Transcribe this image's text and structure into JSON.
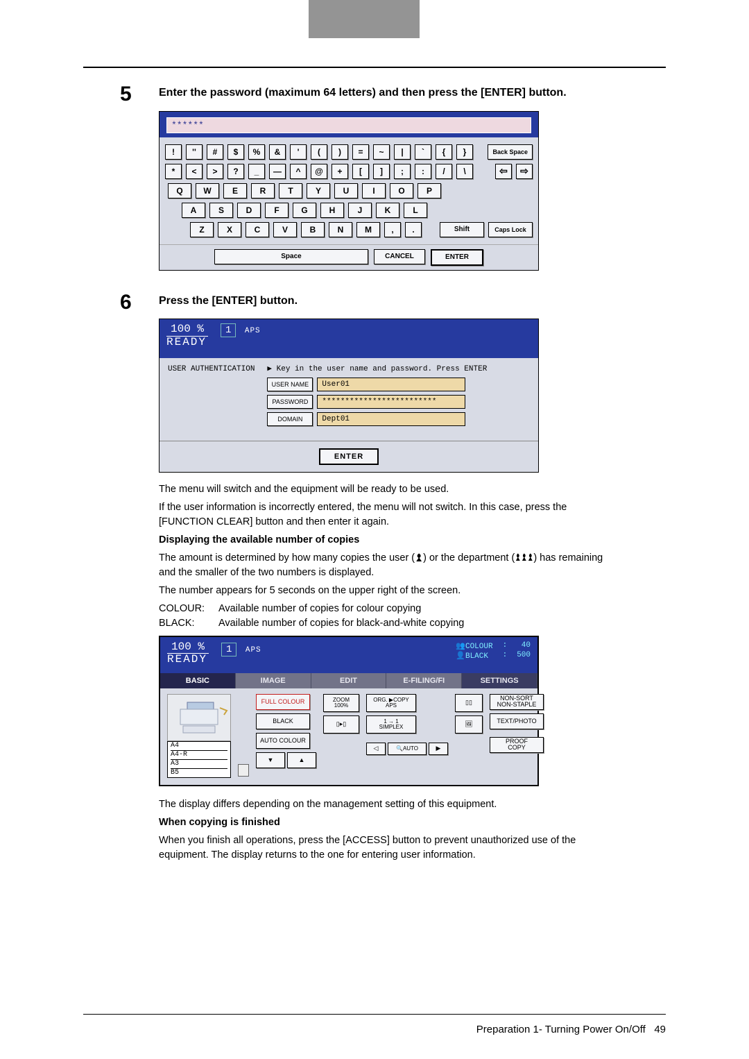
{
  "step5": {
    "num": "5",
    "title": "Enter the password (maximum 64 letters) and then press the [ENTER] button."
  },
  "keyboard": {
    "input_value": "******",
    "row1": [
      "!",
      "''",
      "#",
      "$",
      "%",
      "&",
      "'",
      "(",
      ")",
      "=",
      "~",
      "|",
      "`",
      "{",
      "}"
    ],
    "backspace": "Back Space",
    "row2": [
      "*",
      "<",
      ">",
      "?",
      "_",
      "—",
      "^",
      "@",
      "+",
      "[",
      "]",
      ";",
      ":",
      "/",
      "\\"
    ],
    "arrow_left": "←",
    "arrow_right": "→",
    "row3": [
      "Q",
      "W",
      "E",
      "R",
      "T",
      "Y",
      "U",
      "I",
      "O",
      "P"
    ],
    "row4": [
      "A",
      "S",
      "D",
      "F",
      "G",
      "H",
      "J",
      "K",
      "L"
    ],
    "row5": [
      "Z",
      "X",
      "C",
      "V",
      "B",
      "N",
      "M",
      ",",
      "."
    ],
    "shift": "Shift",
    "caps": "Caps Lock",
    "space": "Space",
    "cancel": "CANCEL",
    "enter": "ENTER"
  },
  "step6": {
    "num": "6",
    "title": "Press the [ENTER] button."
  },
  "auth": {
    "percent": "100",
    "pct_sym": "%",
    "qty": "1",
    "aps": "APS",
    "ready": "READY",
    "section": "USER AUTHENTICATION",
    "instr": "▶ Key in the user name and password. Press ENTER",
    "username_label": "USER NAME",
    "username_value": "User01",
    "password_label": "PASSWORD",
    "password_value": "*************************",
    "domain_label": "DOMAIN",
    "domain_value": "Dept01",
    "enter": "ENTER"
  },
  "after_text": {
    "p1": "The menu will switch and the equipment will be ready to be used.",
    "p2": "If the user information is incorrectly entered, the menu will not switch. In this case, press the [FUNCTION CLEAR] button and then enter it again.",
    "sub1": "Displaying the available number of copies",
    "p3a": "The amount is determined by how many copies the user (",
    "p3b": ") or the department (",
    "p3c": ") has remaining and the smaller of the two numbers is displayed.",
    "p4": "The number appears for 5 seconds on the upper right of the screen.",
    "colour_lbl": "COLOUR:",
    "colour_desc": "Available number of copies for colour copying",
    "black_lbl": "BLACK:",
    "black_desc": "Available number of copies for black-and-white copying"
  },
  "copier": {
    "percent": "100",
    "pct_sym": "%",
    "qty": "1",
    "aps": "APS",
    "ready": "READY",
    "colour_lbl": "COLOUR",
    "colour_val": "40",
    "black_lbl": "BLACK",
    "black_val": "500",
    "sep": ":",
    "tabs": {
      "basic": "BASIC",
      "image": "IMAGE",
      "edit": "EDIT",
      "efile": "E-FILING/FI",
      "settings": "SETTINGS"
    },
    "full_colour": "FULL COLOUR",
    "black": "BLACK",
    "auto_colour": "AUTO COLOUR",
    "zoom": "ZOOM\n100%",
    "org_copy": "ORG. ▶COPY\nAPS",
    "simplex": "1 → 1\nSIMPLEX",
    "nonsort": "NON-SORT\nNON-STAPLE",
    "textphoto": "TEXT/PHOTO",
    "proof": "PROOF\nCOPY",
    "auto": "AUTO",
    "paper": [
      "A4",
      "A4-R",
      "A3",
      "B5"
    ]
  },
  "closing": {
    "p1": "The display differs depending on the management setting of this equipment.",
    "sub": "When copying is finished",
    "p2": "When you finish all operations, press the [ACCESS] button to prevent unauthorized use of the equipment. The display returns to the one for entering user information."
  },
  "footer": {
    "text": "Preparation 1- Turning Power On/Off",
    "page": "49"
  }
}
